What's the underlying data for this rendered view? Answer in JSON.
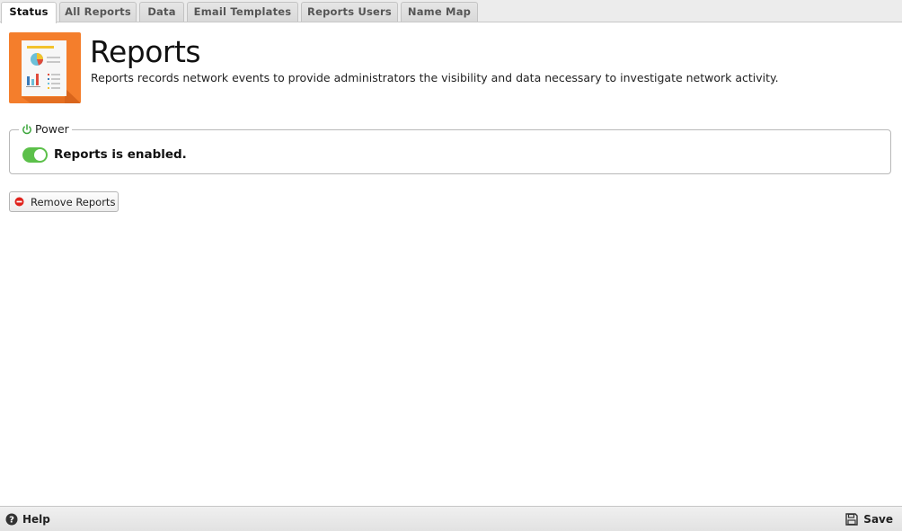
{
  "tabs": [
    {
      "label": "Status",
      "active": true
    },
    {
      "label": "All Reports",
      "active": false
    },
    {
      "label": "Data",
      "active": false
    },
    {
      "label": "Email Templates",
      "active": false
    },
    {
      "label": "Reports Users",
      "active": false
    },
    {
      "label": "Name Map",
      "active": false
    }
  ],
  "header": {
    "title": "Reports",
    "description": "Reports records network events to provide administrators the visibility and data necessary to investigate network activity.",
    "icon": "reports-app-icon"
  },
  "power": {
    "legend": "Power",
    "enabled": true,
    "status_text": "Reports is enabled."
  },
  "actions": {
    "remove_label": "Remove Reports"
  },
  "footer": {
    "help_label": "Help",
    "save_label": "Save"
  },
  "colors": {
    "toggle_on": "#5cc04a",
    "icon_orange": "#f47e2c",
    "remove_red": "#e0211b",
    "power_green": "#3aa53a"
  }
}
